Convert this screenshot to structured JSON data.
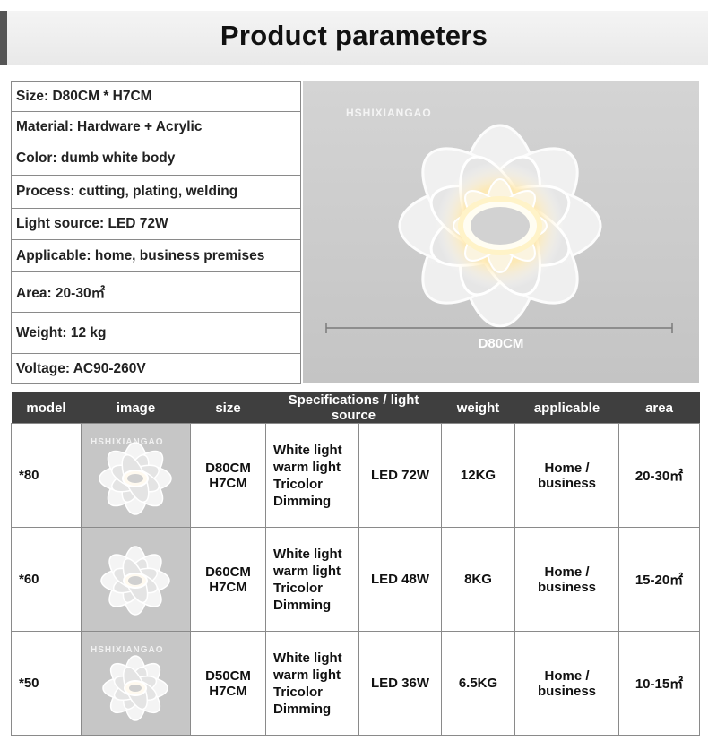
{
  "header": {
    "title": "Product parameters"
  },
  "specs": [
    "Size: D80CM * H7CM",
    "Material: Hardware + Acrylic",
    "Color: dumb white body",
    "Process: cutting, plating, welding",
    "Light source: LED 72W",
    "Applicable: home, business premises",
    "Area: 20-30㎡",
    "Weight: 12 kg",
    "Voltage: AC90-260V"
  ],
  "photo": {
    "watermark": "HSHIXIANGAO",
    "dimension_label": "D80CM"
  },
  "model_table": {
    "headers": [
      "model",
      "image",
      "size",
      "Specifications / light source",
      "weight",
      "applicable",
      "area"
    ],
    "rows": [
      {
        "model": "*80",
        "watermark": "HSHIXIANGAO",
        "size_1": "D80CM",
        "size_2": "H7CM",
        "spec_lines": [
          "White light",
          "warm light",
          "Tricolor",
          "Dimming"
        ],
        "light": "LED 72W",
        "weight": "12KG",
        "app_1": "Home /",
        "app_2": "business",
        "area": "20-30㎡"
      },
      {
        "model": "*60",
        "watermark": "",
        "size_1": "D60CM",
        "size_2": "H7CM",
        "spec_lines": [
          "White light",
          "warm light",
          "Tricolor",
          "Dimming"
        ],
        "light": "LED 48W",
        "weight": "8KG",
        "app_1": "Home /",
        "app_2": "business",
        "area": "15-20㎡"
      },
      {
        "model": "*50",
        "watermark": "HSHIXIANGAO",
        "size_1": "D50CM",
        "size_2": "H7CM",
        "spec_lines": [
          "White light",
          "warm light",
          "Tricolor",
          "Dimming"
        ],
        "light": "LED 36W",
        "weight": "6.5KG",
        "app_1": "Home /",
        "app_2": "business",
        "area": "10-15㎡"
      }
    ]
  }
}
